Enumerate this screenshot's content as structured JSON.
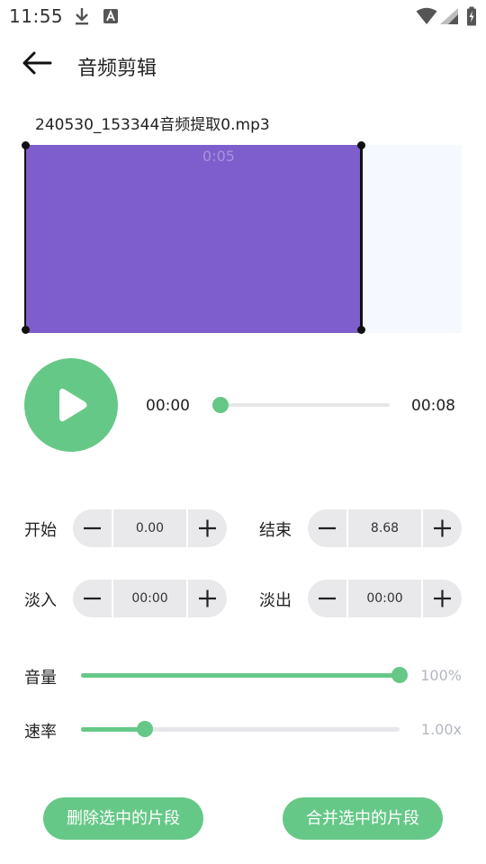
{
  "status_bar": {
    "time": "11:55"
  },
  "app_bar": {
    "title": "音频剪辑"
  },
  "file": {
    "name": "240530_153344音频提取0.mp3"
  },
  "waveform": {
    "selection_time": "0:05",
    "selection_color": "#7e5dcc",
    "background_color": "#f5f8fe"
  },
  "player": {
    "current_time": "00:00",
    "total_time": "00:08",
    "progress": 0.0
  },
  "trim": {
    "start_label": "开始",
    "start_value": "0.00",
    "end_label": "结束",
    "end_value": "8.68"
  },
  "fade": {
    "in_label": "淡入",
    "in_value": "00:00",
    "out_label": "淡出",
    "out_value": "00:00"
  },
  "volume": {
    "label": "音量",
    "value_text": "100%",
    "level": 1.0
  },
  "speed": {
    "label": "速率",
    "value_text": "1.00x",
    "level": 0.2
  },
  "actions": {
    "delete_label": "删除选中的片段",
    "merge_label": "合并选中的片段"
  },
  "colors": {
    "accent": "#66c887",
    "track": "#e7e7ea",
    "stepper_bg": "#e9e9ec"
  },
  "icons": [
    "download-icon",
    "text-a-icon",
    "wifi-icon",
    "signal-icon",
    "battery-icon",
    "back-arrow-icon",
    "play-icon",
    "minus-icon",
    "plus-icon"
  ]
}
